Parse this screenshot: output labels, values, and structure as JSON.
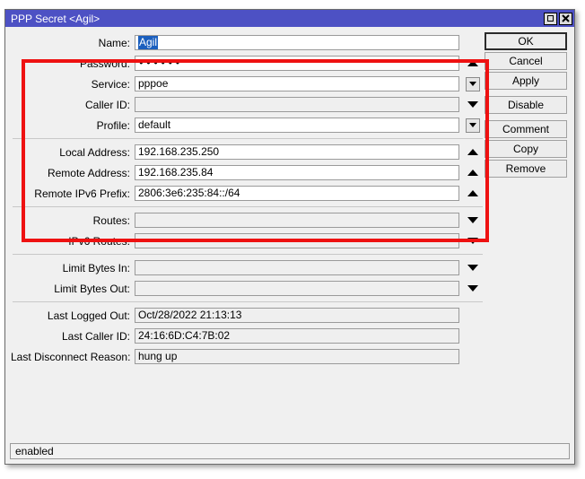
{
  "window": {
    "title": "PPP Secret <Agil>",
    "maximize_icon": "maximize-icon",
    "close_label": "✕"
  },
  "form": {
    "groups": [
      {
        "id": "credentials",
        "rows": [
          {
            "label": "Name:",
            "value": "Agil",
            "selected": true,
            "control": "text",
            "arrow": "none",
            "disabled": false
          },
          {
            "label": "Password:",
            "value": "••••••",
            "masked": true,
            "control": "text",
            "arrow": "up",
            "disabled": false
          },
          {
            "label": "Service:",
            "value": "pppoe",
            "control": "combo",
            "arrow": "combo",
            "disabled": false
          },
          {
            "label": "Caller ID:",
            "value": "",
            "control": "text",
            "arrow": "down",
            "disabled": true
          },
          {
            "label": "Profile:",
            "value": "default",
            "control": "combo",
            "arrow": "combo",
            "disabled": false
          }
        ]
      },
      {
        "id": "addresses",
        "rows": [
          {
            "label": "Local Address:",
            "value": "192.168.235.250",
            "control": "text",
            "arrow": "up",
            "disabled": false
          },
          {
            "label": "Remote Address:",
            "value": "192.168.235.84",
            "control": "text",
            "arrow": "up",
            "disabled": false
          },
          {
            "label": "Remote IPv6 Prefix:",
            "value": "2806:3e6:235:84::/64",
            "control": "text",
            "arrow": "up",
            "disabled": false
          }
        ]
      },
      {
        "id": "routes",
        "rows": [
          {
            "label": "Routes:",
            "value": "",
            "control": "text",
            "arrow": "down",
            "disabled": true
          },
          {
            "label": "IPv6 Routes:",
            "value": "",
            "control": "text",
            "arrow": "down",
            "disabled": true
          }
        ]
      },
      {
        "id": "limits",
        "rows": [
          {
            "label": "Limit Bytes In:",
            "value": "",
            "control": "text",
            "arrow": "down",
            "disabled": true
          },
          {
            "label": "Limit Bytes Out:",
            "value": "",
            "control": "text",
            "arrow": "down",
            "disabled": true
          }
        ]
      },
      {
        "id": "lastinfo",
        "rows": [
          {
            "label": "Last Logged Out:",
            "value": "Oct/28/2022 21:13:13",
            "control": "text",
            "arrow": "none",
            "readonly": true
          },
          {
            "label": "Last Caller ID:",
            "value": "24:16:6D:C4:7B:02",
            "control": "text",
            "arrow": "none",
            "readonly": true
          },
          {
            "label": "Last Disconnect Reason:",
            "value": "hung up",
            "control": "text",
            "arrow": "none",
            "readonly": true
          }
        ]
      }
    ]
  },
  "buttons": [
    {
      "label": "OK",
      "name": "ok-button",
      "default": true,
      "gap": false
    },
    {
      "label": "Cancel",
      "name": "cancel-button",
      "default": false,
      "gap": false
    },
    {
      "label": "Apply",
      "name": "apply-button",
      "default": false,
      "gap": false
    },
    {
      "label": "Disable",
      "name": "disable-button",
      "default": false,
      "gap": true
    },
    {
      "label": "Comment",
      "name": "comment-button",
      "default": false,
      "gap": true
    },
    {
      "label": "Copy",
      "name": "copy-button",
      "default": false,
      "gap": false
    },
    {
      "label": "Remove",
      "name": "remove-button",
      "default": false,
      "gap": false
    }
  ],
  "statusbar": {
    "text": "enabled"
  },
  "annotation": {
    "shape": "rectangle",
    "color": "#ee1111"
  }
}
